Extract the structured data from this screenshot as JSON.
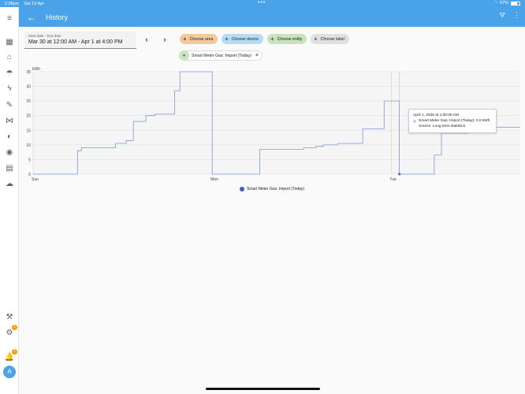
{
  "status_bar": {
    "time": "2:06pm",
    "date": "Sat 19 Apr",
    "battery": "67%",
    "dots": "•••"
  },
  "header": {
    "title": "History",
    "back_icon": "arrow-left-icon",
    "filter_icon": "filter-remove-icon",
    "menu_icon": "more-vertical-icon",
    "color": "#4aa3e8"
  },
  "sidebar": {
    "items": [
      {
        "name": "menu",
        "icon": "≡"
      },
      {
        "name": "overview",
        "icon": "▦"
      },
      {
        "name": "map",
        "icon": "⌂"
      },
      {
        "name": "energy",
        "icon": "☂"
      },
      {
        "name": "lightning",
        "icon": "ϟ"
      },
      {
        "name": "tools",
        "icon": "✎"
      },
      {
        "name": "vscode",
        "icon": "⋈"
      },
      {
        "name": "hacs",
        "icon": "◐"
      },
      {
        "name": "media",
        "icon": "◉"
      },
      {
        "name": "devices",
        "icon": "▤"
      },
      {
        "name": "cloud",
        "icon": "☁"
      }
    ],
    "developer_icon": "⚒",
    "settings_badge": "1",
    "notifications_badge": "1",
    "avatar": "A"
  },
  "filters": {
    "date_label": "Start date - End date",
    "date_value": "Mar 30 at 12:00 AM - Apr 1 at 4:00 PM",
    "prev": "‹",
    "next": "›",
    "chips": [
      {
        "label": "Choose area",
        "color": "#f6c999"
      },
      {
        "label": "Choose device",
        "color": "#b5dcf5"
      },
      {
        "label": "Choose entity",
        "color": "#c6e3ba"
      },
      {
        "label": "Choose label",
        "color": "#e0e0e0"
      }
    ],
    "entity_chip": "Smart Meter Gas: Import (Today)",
    "remove": "×"
  },
  "chart_data": {
    "type": "line",
    "ylabel": "kWh",
    "ylim": [
      0,
      35
    ],
    "yticks": [
      "0",
      "5",
      "10",
      "15",
      "20",
      "25",
      "30",
      "35"
    ],
    "xticks": [
      "Sun",
      "Mon",
      "Tue"
    ],
    "series": [
      {
        "name": "Smart Meter Gas: Import (Today)",
        "color": "#7d95d9",
        "x": [
          0,
          0.248,
          0.248,
          0.27,
          0.27,
          0.36,
          0.36,
          0.46,
          0.46,
          0.49,
          0.49,
          0.52,
          0.52,
          0.56,
          0.56,
          0.63,
          0.63,
          0.68,
          0.68,
          0.79,
          0.79,
          0.82,
          0.82,
          0.84,
          0.84,
          0.9,
          0.9,
          0.96,
          0.96,
          1.0,
          1.0,
          1.265,
          1.265,
          1.51,
          1.51,
          1.58,
          1.58,
          1.62,
          1.62,
          1.7,
          1.7,
          1.84,
          1.84,
          1.96,
          1.96,
          2.04,
          2.04,
          2.045,
          2.045,
          2.24,
          2.24,
          2.28,
          2.28,
          2.43,
          2.43,
          2.72
        ],
        "y": [
          0,
          0,
          8,
          8,
          9,
          9,
          9,
          9,
          10.5,
          10.5,
          10.5,
          10.5,
          11.5,
          11.5,
          18,
          18,
          20,
          20,
          20.5,
          20.5,
          28.5,
          28.5,
          35,
          35,
          35,
          35,
          35,
          35,
          35,
          35,
          0,
          0,
          8.5,
          8.5,
          9,
          9,
          9.5,
          9.5,
          10,
          10,
          10.5,
          10.5,
          15.5,
          15.5,
          25,
          25,
          25,
          25,
          0,
          0,
          6.5,
          6.5,
          14,
          14,
          16,
          16
        ]
      }
    ],
    "hover_x": 2.045,
    "tooltip": {
      "title": "April 1, 2025 at 1:00:00 AM",
      "line": "Smart Meter Gas: Import (Today): 0.0 kWh",
      "source": "Source: Long term statistics"
    },
    "legend": "Smart Meter Gas: Import (Today)"
  }
}
